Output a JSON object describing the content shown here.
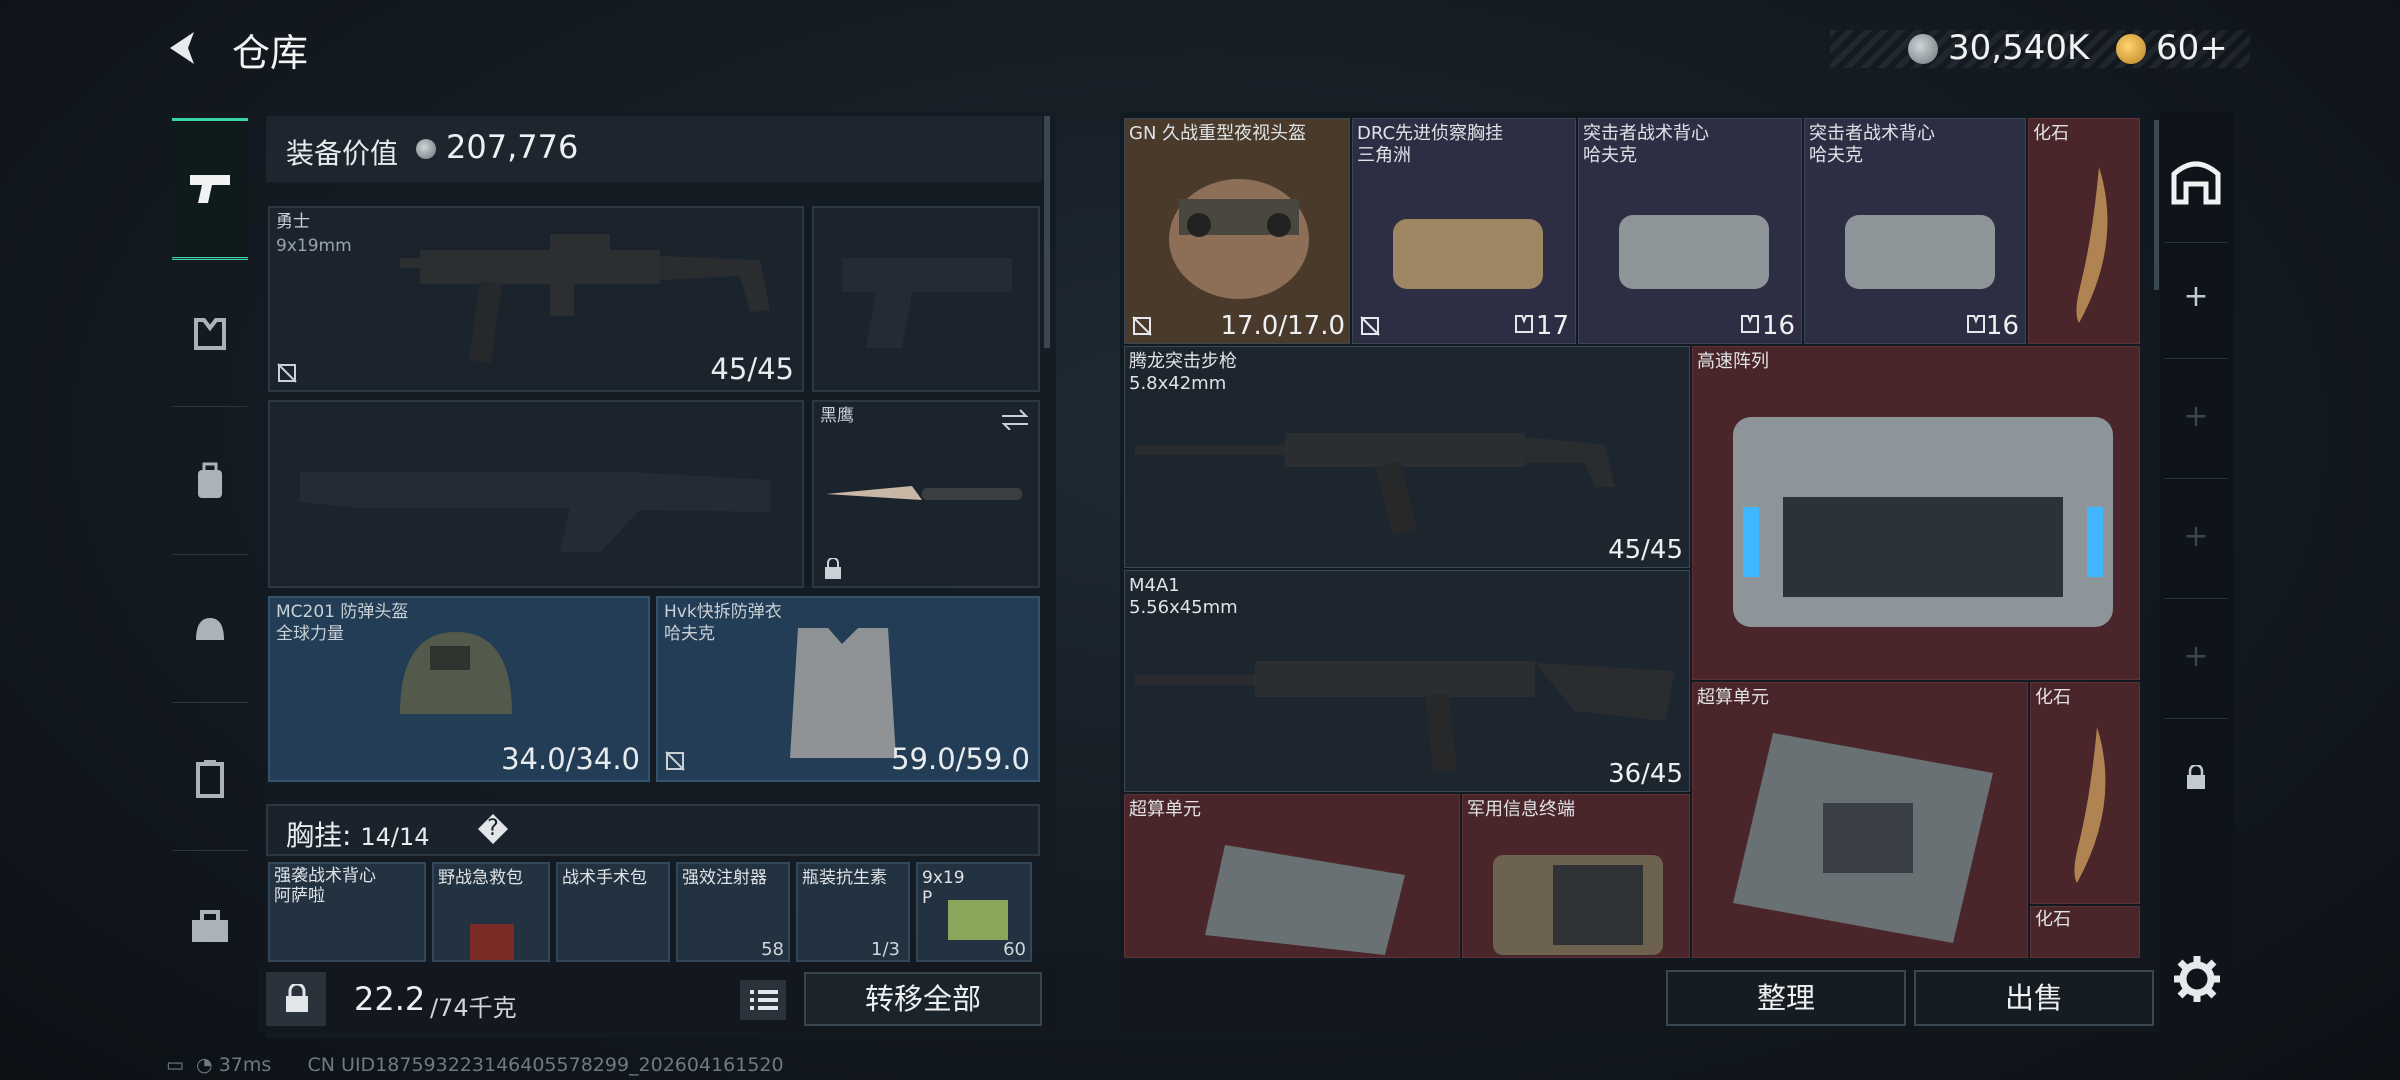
{
  "header": {
    "title": "仓库",
    "money": "30,540K",
    "tickets": "60",
    "tickets_plus": "+"
  },
  "left": {
    "value_label": "装备价值",
    "value_num": "207,776",
    "weapon1": {
      "name": "勇士",
      "caliber": "9x19mm",
      "ammo": "45/45"
    },
    "knife": {
      "name": "黑鹰"
    },
    "helmet": {
      "name": "MC201 防弹头盔",
      "maker": "全球力量",
      "durability": "34.0/34.0"
    },
    "armor": {
      "name": "Hvk快拆防弹衣",
      "maker": "哈夫克",
      "durability": "59.0/59.0"
    },
    "chest": {
      "label": "胸挂:",
      "count": "14/14",
      "help": "?"
    },
    "mini_items": [
      {
        "name": "强袭战术背心",
        "sub": "阿萨啦"
      },
      {
        "name": "野战急救包",
        "sub": ""
      },
      {
        "name": "战术手术包",
        "sub": ""
      },
      {
        "name": "强效注射器",
        "sub": "",
        "val": "58"
      },
      {
        "name": "瓶装抗生素",
        "sub": "",
        "val": "1/3"
      },
      {
        "name": "9x19",
        "sub": "P",
        "val": "60"
      }
    ],
    "weight_main": "22.2",
    "weight_cap": "/74千克",
    "transfer_label": "转移全部"
  },
  "right": {
    "cells": [
      {
        "name": "GN 久战重型夜视头盔",
        "sub": "",
        "val": "17.0/17.0"
      },
      {
        "name": "DRC先进侦察胸挂",
        "sub": "三角洲",
        "val": "17"
      },
      {
        "name": "突击者战术背心",
        "sub": "哈夫克",
        "val": "16"
      },
      {
        "name": "突击者战术背心",
        "sub": "哈夫克",
        "val": "16"
      },
      {
        "name": "化石",
        "sub": "",
        "val": ""
      },
      {
        "name": "腾龙突击步枪",
        "sub": "5.8x42mm",
        "val": "45/45"
      },
      {
        "name": "高速阵列",
        "sub": "",
        "val": ""
      },
      {
        "name": "M4A1",
        "sub": "5.56x45mm",
        "val": "36/45"
      },
      {
        "name": "超算单元",
        "sub": "",
        "val": ""
      },
      {
        "name": "化石",
        "sub": "",
        "val": ""
      },
      {
        "name": "超算单元",
        "sub": "",
        "val": ""
      },
      {
        "name": "军用信息终端",
        "sub": "",
        "val": ""
      },
      {
        "name": "化石",
        "sub": "",
        "val": ""
      }
    ],
    "tidy_label": "整理",
    "sell_label": "出售"
  },
  "status": {
    "ping": "37ms",
    "uid": "CN UID1875932231464055782​99_202604161520"
  },
  "colors": {
    "accent": "#38d6a6",
    "red_cell": "#4a2529",
    "blue_slot": "#223d55"
  },
  "icons": [
    "back-arrow-icon",
    "silver-coin-icon",
    "gold-coin-icon",
    "pistol-icon",
    "armor-nav-icon",
    "backpack-nav-icon",
    "helmet-nav-icon",
    "case-nav-icon",
    "toolbox-nav-icon",
    "helmet-slot-icon",
    "plus-icon",
    "lock-icon",
    "gear-icon",
    "list-icon",
    "swap-icon"
  ]
}
